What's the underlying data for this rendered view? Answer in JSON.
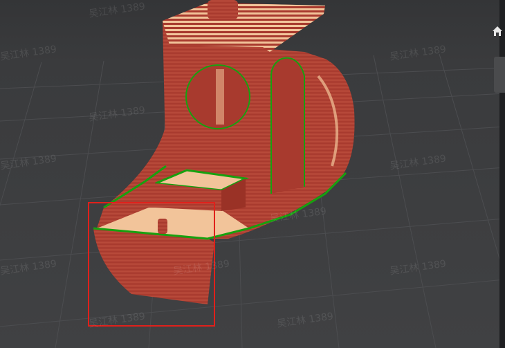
{
  "watermark": {
    "text": "吴江林 1389"
  },
  "colors": {
    "background": "#3e3f41",
    "grid_line": "#4c4d50",
    "model_wall": "#a83a2e",
    "model_infill": "#f2c49a",
    "perimeter_highlight": "#17a10f",
    "selection_box": "#e0201b",
    "side_panel": "#1f2022"
  },
  "icons": {
    "home": "home-icon"
  },
  "selection": {
    "description_shape": "rectangle"
  }
}
